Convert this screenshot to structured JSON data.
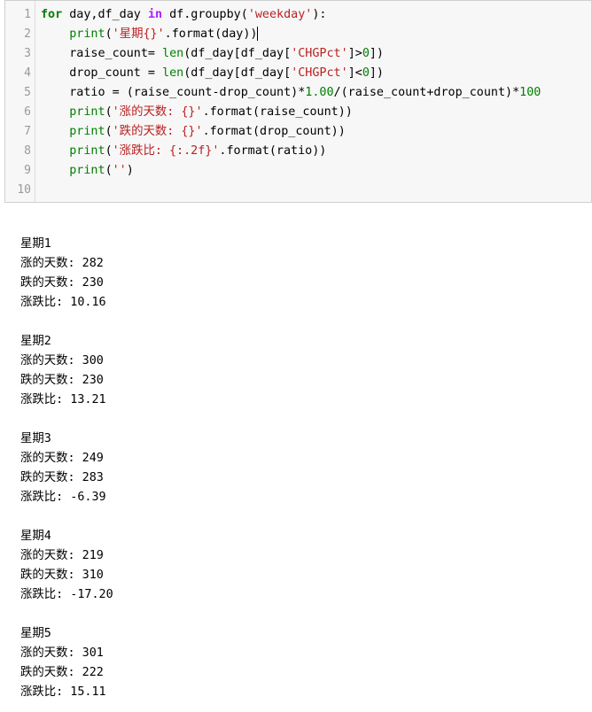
{
  "editor": {
    "line_numbers": [
      "1",
      "2",
      "3",
      "4",
      "5",
      "6",
      "7",
      "8",
      "9",
      "10"
    ]
  },
  "output": {
    "lines": [
      "星期1",
      "涨的天数: 282",
      "跌的天数: 230",
      "涨跌比: 10.16",
      "",
      "星期2",
      "涨的天数: 300",
      "跌的天数: 230",
      "涨跌比: 13.21",
      "",
      "星期3",
      "涨的天数: 249",
      "跌的天数: 283",
      "涨跌比: -6.39",
      "",
      "星期4",
      "涨的天数: 219",
      "跌的天数: 310",
      "涨跌比: -17.20",
      "",
      "星期5",
      "涨的天数: 301",
      "跌的天数: 222",
      "涨跌比: 15.11"
    ]
  },
  "code": {
    "l1": {
      "kw_for": "for",
      "vars": " day,df_day ",
      "kw_in": "in",
      "call": " df.groupby(",
      "str": "'weekday'",
      "end": "):"
    },
    "l2": {
      "indent": "    ",
      "fn": "print",
      "open": "(",
      "str": "'星期{}'",
      "rest": ".format(day))"
    },
    "l3": {
      "indent": "    ",
      "lhs": "raise_count= ",
      "fn": "len",
      "mid": "(df_day[df_day[",
      "str": "'CHGPct'",
      "cmp": "]>",
      "num": "0",
      "end": "])"
    },
    "l4": {
      "indent": "    ",
      "lhs": "drop_count = ",
      "fn": "len",
      "mid": "(df_day[df_day[",
      "str": "'CHGPct'",
      "cmp": "]<",
      "num": "0",
      "end": "])"
    },
    "l5": {
      "indent": "    ",
      "lhs": "ratio = (raise_count-drop_count)*",
      "num1": "1.00",
      "mid": "/(raise_count+drop_count)*",
      "num2": "100"
    },
    "l6": {
      "indent": "    ",
      "fn": "print",
      "open": "(",
      "str": "'涨的天数: {}'",
      "rest": ".format(raise_count))"
    },
    "l7": {
      "indent": "    ",
      "fn": "print",
      "open": "(",
      "str": "'跌的天数: {}'",
      "rest": ".format(drop_count))"
    },
    "l8": {
      "indent": "    ",
      "fn": "print",
      "open": "(",
      "str": "'涨跌比: {:.2f}'",
      "rest": ".format(ratio))"
    },
    "l9": {
      "indent": "    ",
      "fn": "print",
      "open": "(",
      "str": "''",
      "rest": ")"
    }
  },
  "colors": {
    "keyword": "#008000",
    "string": "#ba2121",
    "number": "#008000",
    "gutter_text": "#999999",
    "editor_bg": "#f7f7f7"
  }
}
